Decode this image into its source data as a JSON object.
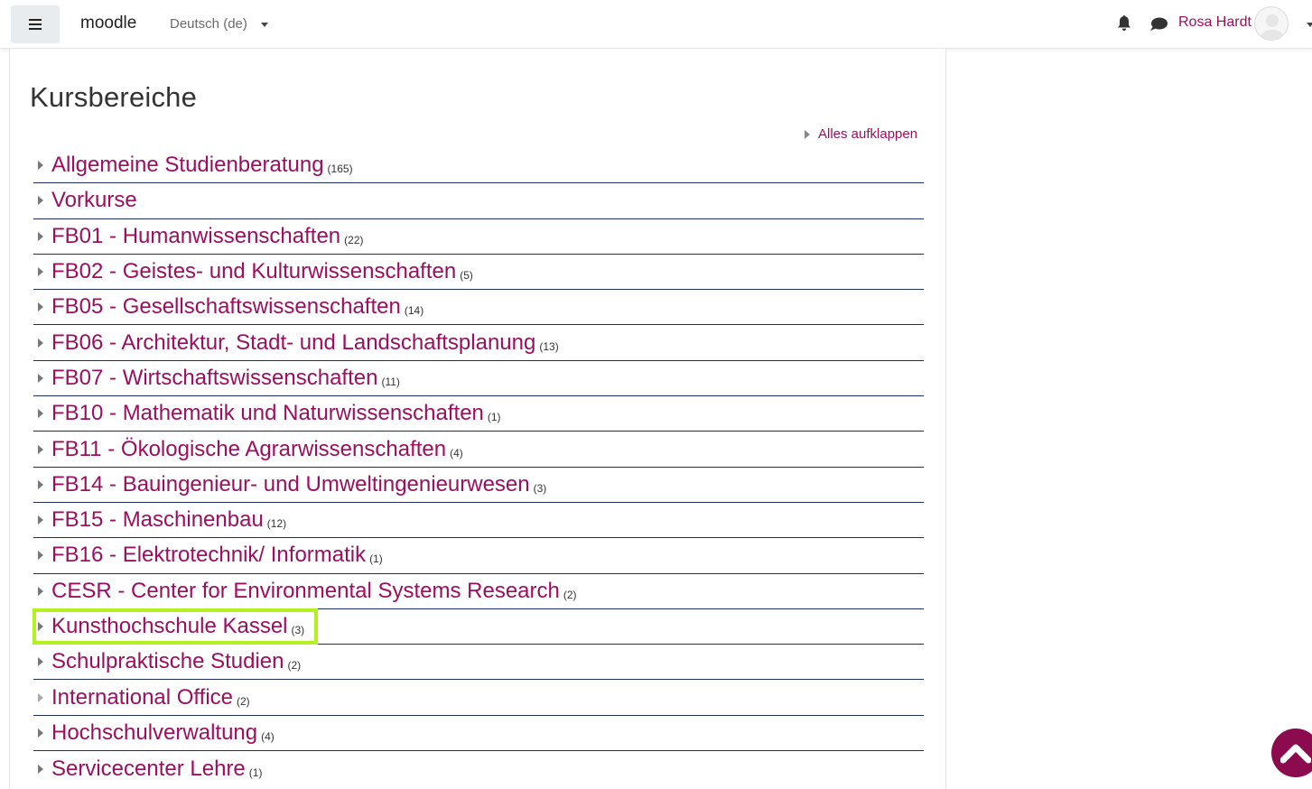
{
  "navbar": {
    "menu_icon": "hamburger-icon",
    "brand": "moodle",
    "language": "Deutsch (de)",
    "notification_icon": "bell-icon",
    "messages_icon": "chat-bubble-icon",
    "user_name": "Rosa Hardt",
    "user_avatar_icon": "avatar-icon"
  },
  "main": {
    "title": "Kursbereiche",
    "expand_all": "Alles aufklappen",
    "categories": [
      {
        "name": "Allgemeine Studienberatung",
        "count": "(165)"
      },
      {
        "name": "Vorkurse",
        "count": ""
      },
      {
        "name": "FB01 - Humanwissenschaften",
        "count": "(22)"
      },
      {
        "name": "FB02 - Geistes- und Kulturwissenschaften",
        "count": "(5)"
      },
      {
        "name": "FB05 - Gesellschaftswissenschaften",
        "count": "(14)"
      },
      {
        "name": "FB06 - Architektur, Stadt- und Landschaftsplanung",
        "count": "(13)"
      },
      {
        "name": "FB07 - Wirtschaftswissenschaften",
        "count": "(11)"
      },
      {
        "name": "FB10 - Mathematik und Naturwissenschaften",
        "count": "(1)"
      },
      {
        "name": "FB11 - Ökologische Agrarwissenschaften",
        "count": "(4)"
      },
      {
        "name": "FB14 - Bauingenieur- und Umweltingenieurwesen",
        "count": "(3)"
      },
      {
        "name": "FB15 - Maschinenbau",
        "count": "(12)"
      },
      {
        "name": "FB16 - Elektrotechnik/ Informatik",
        "count": "(1)"
      },
      {
        "name": "CESR - Center for Environmental Systems Research",
        "count": "(2)"
      },
      {
        "name": "Kunsthochschule Kassel",
        "count": "(3)"
      },
      {
        "name": "Schulpraktische Studien",
        "count": "(2)"
      },
      {
        "name": "International Office",
        "count": "(2)"
      },
      {
        "name": "Hochschulverwaltung",
        "count": "(4)"
      },
      {
        "name": "Servicecenter Lehre",
        "count": "(1)"
      }
    ]
  },
  "colors": {
    "link": "#9b0f5f",
    "highlight": "#b5f020",
    "row_border": "#1e2f5a",
    "back_to_top": "#8c0a4e"
  },
  "back_to_top_icon": "chevron-up-icon"
}
